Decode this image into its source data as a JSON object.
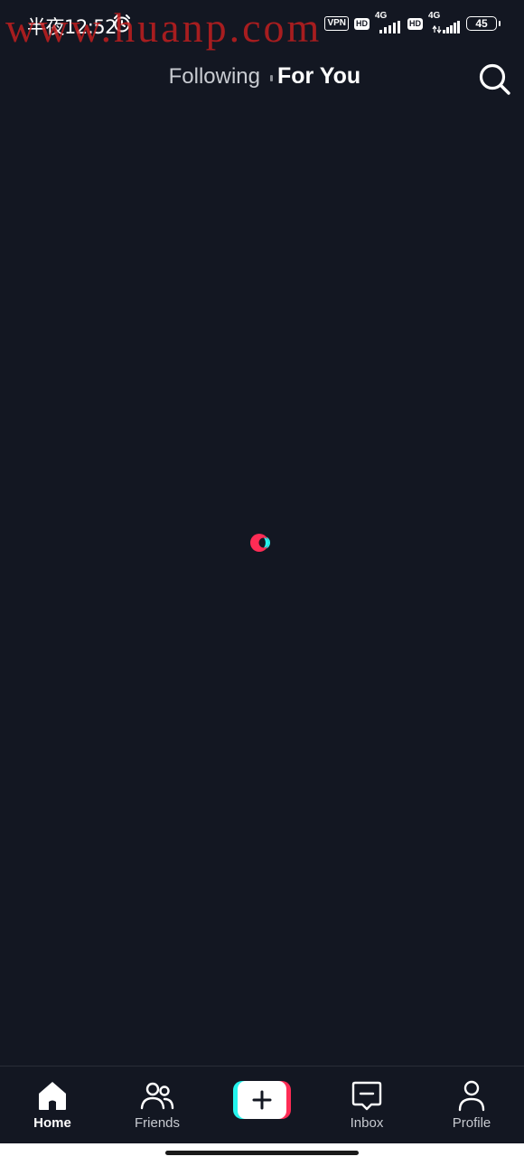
{
  "status_bar": {
    "time": "半夜12:52",
    "watermark": "www.huanp.com",
    "vpn": "VPN",
    "hd1": "HD",
    "net1": "4G",
    "hd2": "HD",
    "net2": "4G",
    "battery": "45"
  },
  "top_nav": {
    "tabs": [
      {
        "label": "Following",
        "active": false
      },
      {
        "label": "For You",
        "active": true
      }
    ],
    "search_icon": "search-icon"
  },
  "loader": {
    "colors": {
      "pink": "#fe2c55",
      "cyan": "#25f4ee"
    }
  },
  "bottom_nav": {
    "items": [
      {
        "label": "Home",
        "icon": "home-icon",
        "active": true
      },
      {
        "label": "Friends",
        "icon": "friends-icon",
        "active": false
      },
      {
        "label": "",
        "icon": "plus-icon",
        "active": false
      },
      {
        "label": "Inbox",
        "icon": "inbox-icon",
        "active": false
      },
      {
        "label": "Profile",
        "icon": "profile-icon",
        "active": false
      }
    ]
  },
  "colors": {
    "background": "#131722",
    "accent_pink": "#fe2c55",
    "accent_cyan": "#25f4ee"
  }
}
